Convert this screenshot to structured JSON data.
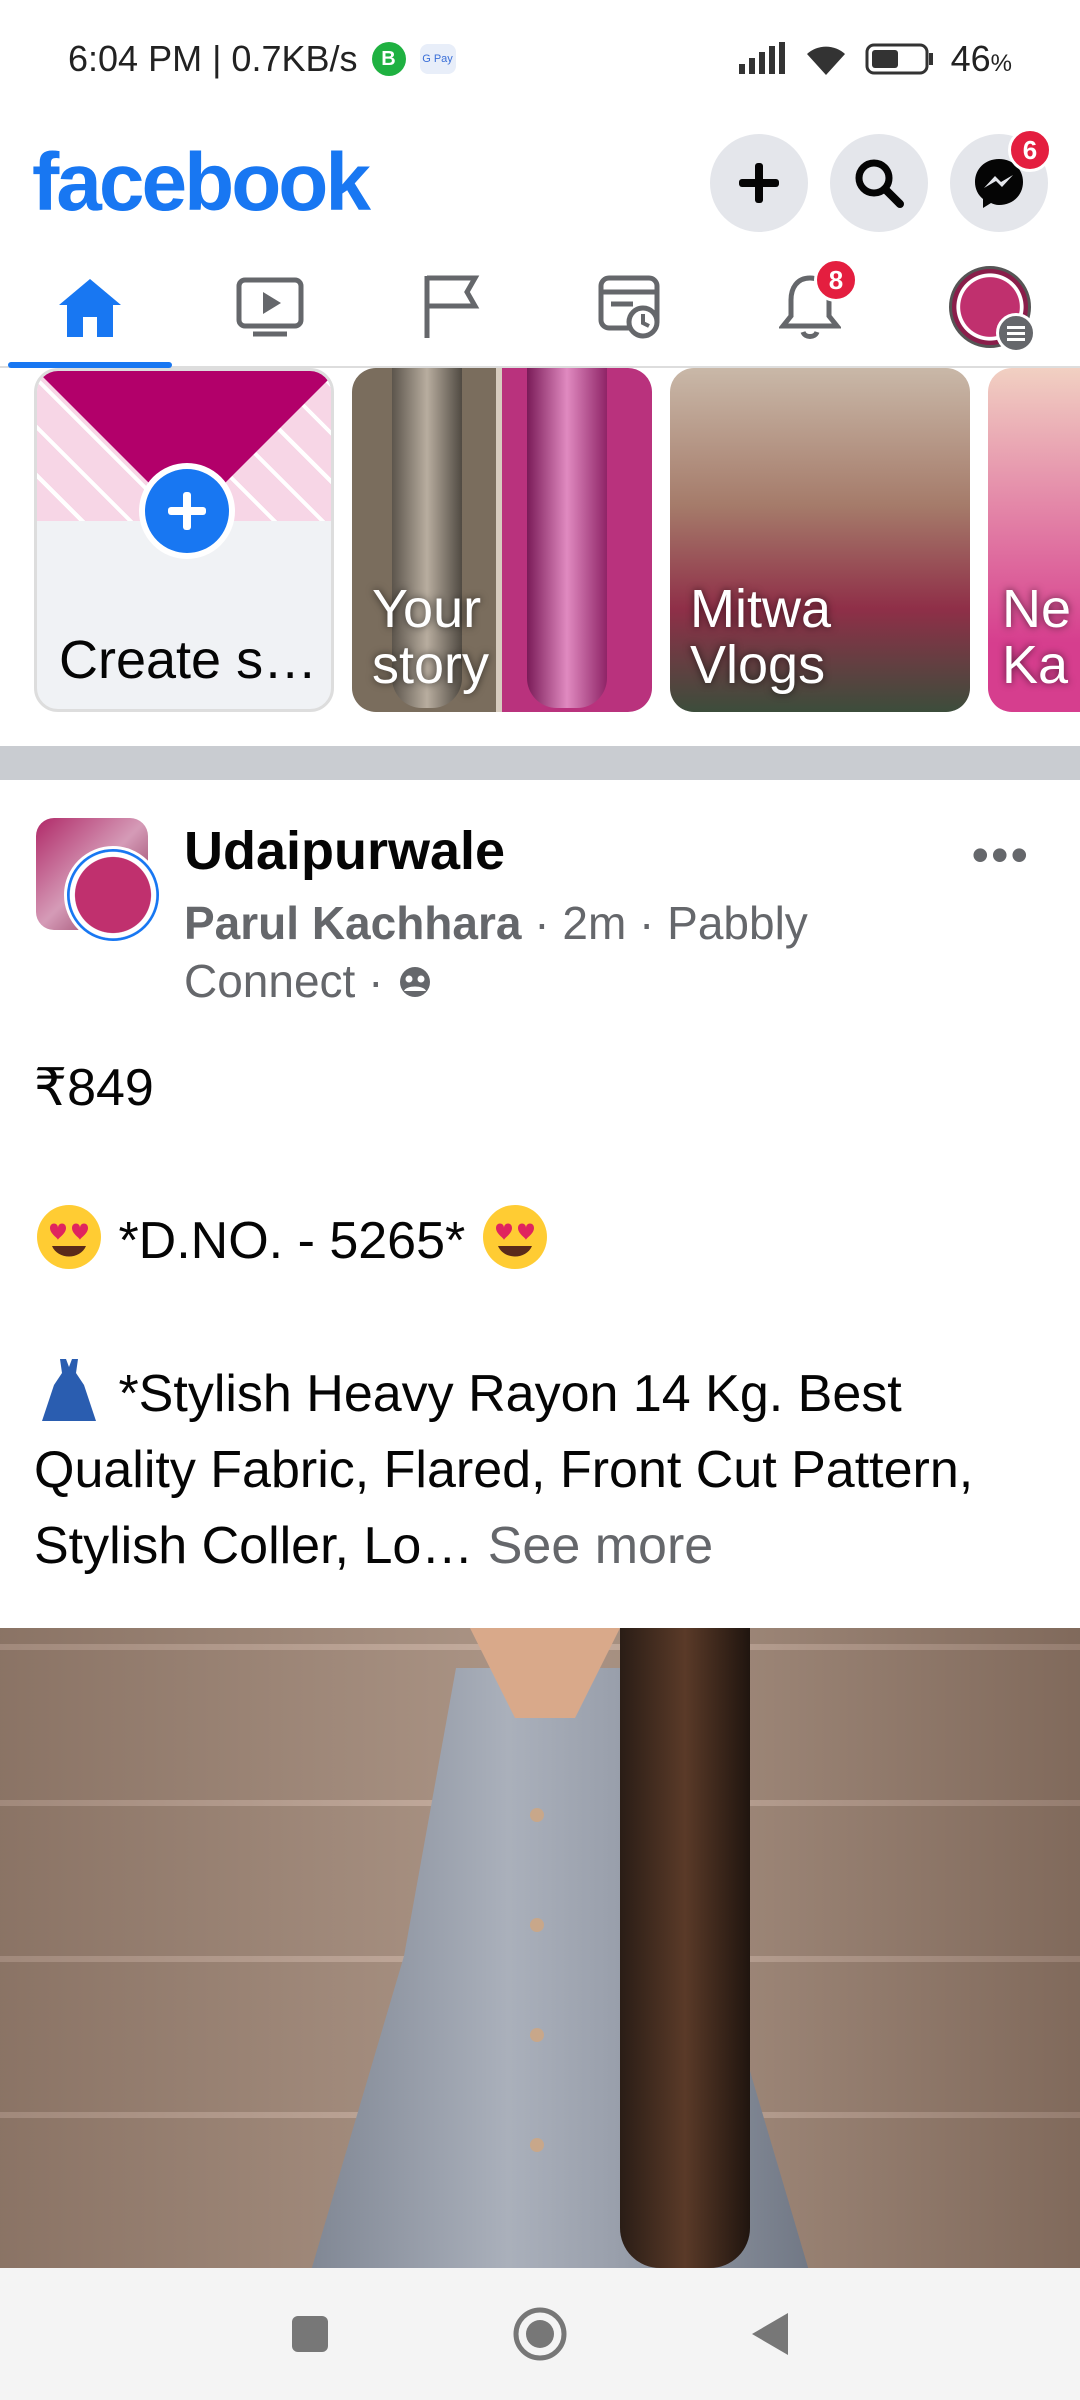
{
  "status_bar": {
    "time_speed": "6:04 PM | 0.7KB/s",
    "battery": "46",
    "battery_unit": "%"
  },
  "header": {
    "logo": "facebook",
    "messenger_badge": "6"
  },
  "tabs": {
    "notifications_badge": "8"
  },
  "stories": [
    {
      "label": "Create s…"
    },
    {
      "label": "Your story"
    },
    {
      "label": "Mitwa Vlogs"
    },
    {
      "label": "Ne Ka"
    }
  ],
  "post": {
    "page_name": "Udaipurwale",
    "author": "Parul Kachhara",
    "meta": " · 2m · Pabbly Connect · ",
    "price": "₹849",
    "design_no": " *D.NO. - 5265* ",
    "description": " *Stylish Heavy Rayon 14 Kg. Best Quality Fabric, Flared, Front Cut Pattern, Stylish Coller, Lo… ",
    "see_more": "See more"
  },
  "colors": {
    "brand": "#1877f2",
    "badge": "#e41e3f"
  }
}
